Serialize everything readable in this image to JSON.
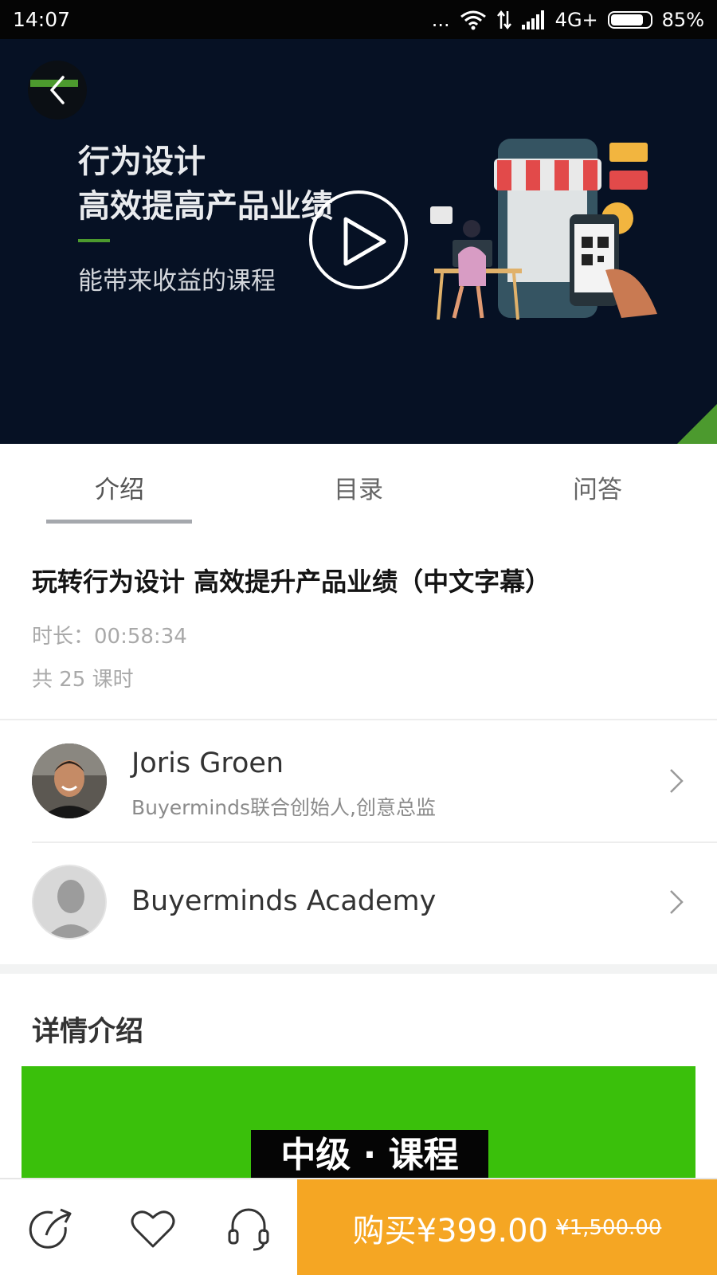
{
  "status_bar": {
    "time": "14:07",
    "signal_dots": "...",
    "network": "4G+",
    "battery": "85%",
    "battery_level": 0.85
  },
  "hero": {
    "title_line1": "行为设计",
    "title_line2": "高效提高产品业绩",
    "subtitle": "能带来收益的课程",
    "accent_color": "#4c9a2e",
    "background_color": "#061124"
  },
  "tabs": [
    {
      "label": "介绍",
      "active": true
    },
    {
      "label": "目录",
      "active": false
    },
    {
      "label": "问答",
      "active": false
    }
  ],
  "course": {
    "title": "玩转行为设计 高效提升产品业绩（中文字幕）",
    "duration": "时长：00:58:34",
    "lessons": "共 25 课时"
  },
  "instructors": [
    {
      "name": "Joris Groen",
      "description": "Buyerminds联合创始人,创意总监",
      "avatar": "instructor-photo"
    },
    {
      "name": "Buyerminds Academy",
      "description": "",
      "avatar": "default-avatar"
    }
  ],
  "details": {
    "heading": "详情介绍",
    "banner_tag": "中级 · 课程",
    "banner_color": "#3ac00b"
  },
  "bottom_bar": {
    "icons": [
      "share-icon",
      "favorite-heart-icon",
      "customer-service-headset-icon"
    ],
    "buy_label": "购买¥399.00",
    "original_price": "¥1,500.00",
    "buy_color": "#f5a623"
  }
}
